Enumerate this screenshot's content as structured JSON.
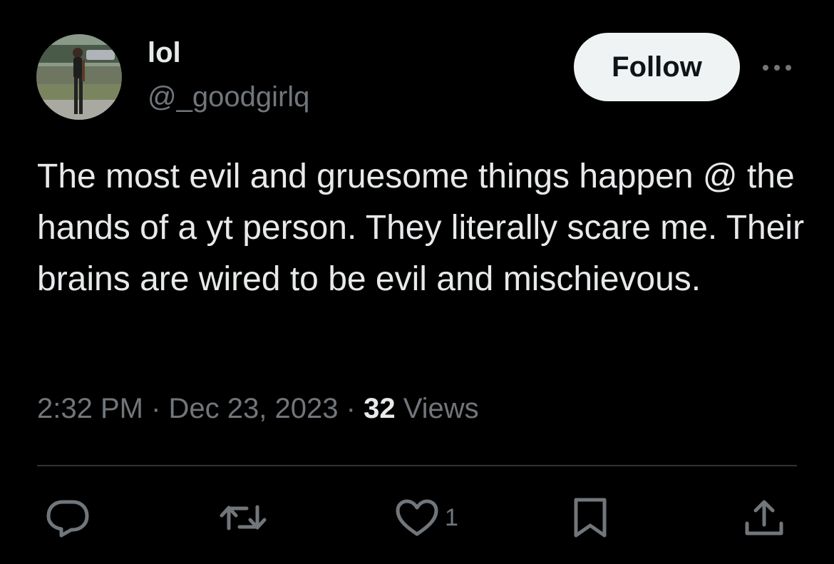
{
  "user": {
    "display_name": "lol",
    "handle": "@_goodgirlq",
    "avatar_icon": "profile-photo"
  },
  "follow_label": "Follow",
  "more_icon": "ellipsis-icon",
  "tweet": {
    "text": "The most evil and gruesome things happen @ the hands of a yt person. They literally scare me. Their brains are wired to be evil and mischievous."
  },
  "meta": {
    "time": "2:32 PM",
    "separator": "·",
    "date": "Dec 23, 2023",
    "views_count": "32",
    "views_label": "Views"
  },
  "actions": {
    "reply_icon": "reply-icon",
    "retweet_icon": "retweet-icon",
    "like_icon": "heart-icon",
    "like_count": "1",
    "bookmark_icon": "bookmark-icon",
    "share_icon": "share-icon"
  },
  "colors": {
    "background": "#000000",
    "primary_text": "#e7e9ea",
    "secondary_text": "#71767b",
    "follow_bg": "#eff3f4",
    "divider": "#2f3336"
  }
}
